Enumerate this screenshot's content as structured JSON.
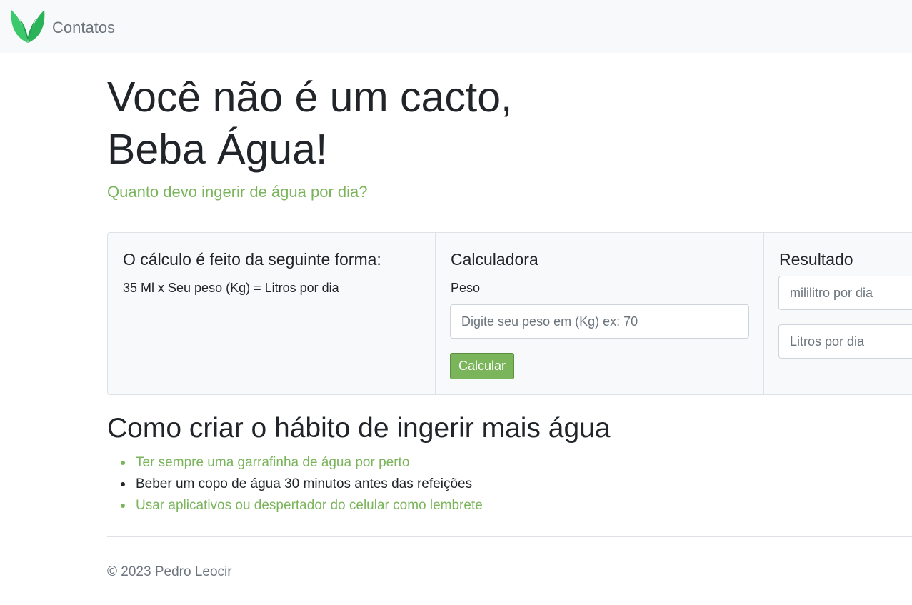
{
  "navbar": {
    "logo_icon": "leaf-logo-icon",
    "link_label": "Contatos"
  },
  "hero": {
    "title_line1": "Você não é um cacto,",
    "title_line2": "Beba Água!",
    "subtitle": "Quanto devo ingerir de água por dia?"
  },
  "calc_info": {
    "title": "O cálculo é feito da seguinte forma:",
    "formula": "35 Ml x Seu peso (Kg) = Litros por dia"
  },
  "calculator": {
    "title": "Calculadora",
    "weight_label": "Peso",
    "weight_value": "",
    "weight_placeholder": "Digite seu peso em (Kg) ex: 70",
    "button_label": "Calcular"
  },
  "result": {
    "title": "Resultado",
    "ml_value": "",
    "ml_placeholder": "mililitro por dia",
    "liters_value": "",
    "liters_placeholder": "Litros por dia"
  },
  "habits": {
    "title": "Como criar o hábito de ingerir mais água",
    "items": [
      {
        "text": "Ter sempre uma garrafinha de água por perto"
      },
      {
        "text": "Beber um copo de água 30 minutos antes das refeições"
      },
      {
        "text": "Usar aplicativos ou despertador do celular como lembrete"
      }
    ]
  },
  "footer": {
    "copyright": "© 2023 Pedro Leocir"
  },
  "colors": {
    "accent": "#7ab55c",
    "navbar_bg": "#f8f9fa",
    "text": "#212529",
    "muted": "#6c757d",
    "logo_light": "#3cc96b",
    "logo_dark": "#1a9e4a"
  }
}
